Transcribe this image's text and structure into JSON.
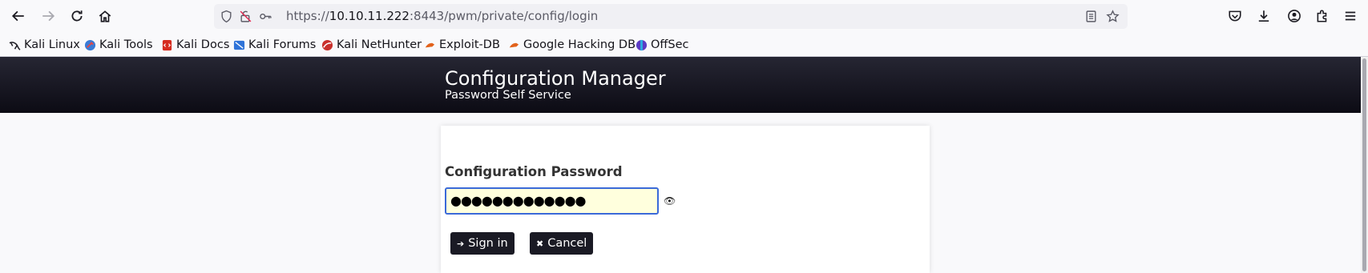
{
  "browser": {
    "url_prefix": "https://",
    "url_host": "10.10.11.222",
    "url_rest": ":8443/pwm/private/config/login",
    "bookmarks": [
      {
        "label": "Kali Linux",
        "icon": "kali-dragon-icon"
      },
      {
        "label": "Kali Tools",
        "icon": "kali-tools-icon"
      },
      {
        "label": "Kali Docs",
        "icon": "kali-docs-icon"
      },
      {
        "label": "Kali Forums",
        "icon": "kali-forums-icon"
      },
      {
        "label": "Kali NetHunter",
        "icon": "nethunter-icon"
      },
      {
        "label": "Exploit-DB",
        "icon": "exploit-db-icon"
      },
      {
        "label": "Google Hacking DB",
        "icon": "ghdb-icon"
      },
      {
        "label": "OffSec",
        "icon": "offsec-icon"
      }
    ]
  },
  "header": {
    "title": "Configuration Manager",
    "subtitle": "Password Self Service"
  },
  "form": {
    "label": "Configuration Password",
    "password_masked": "●●●●●●●●●●●●●",
    "eye_icon": "👁",
    "signin_label": "Sign in",
    "cancel_label": "Cancel"
  },
  "colors": {
    "header": "#0c0b14",
    "input_focus": "#3b6ad8",
    "input_bg": "#ffffdd",
    "button": "#1a1a24"
  }
}
